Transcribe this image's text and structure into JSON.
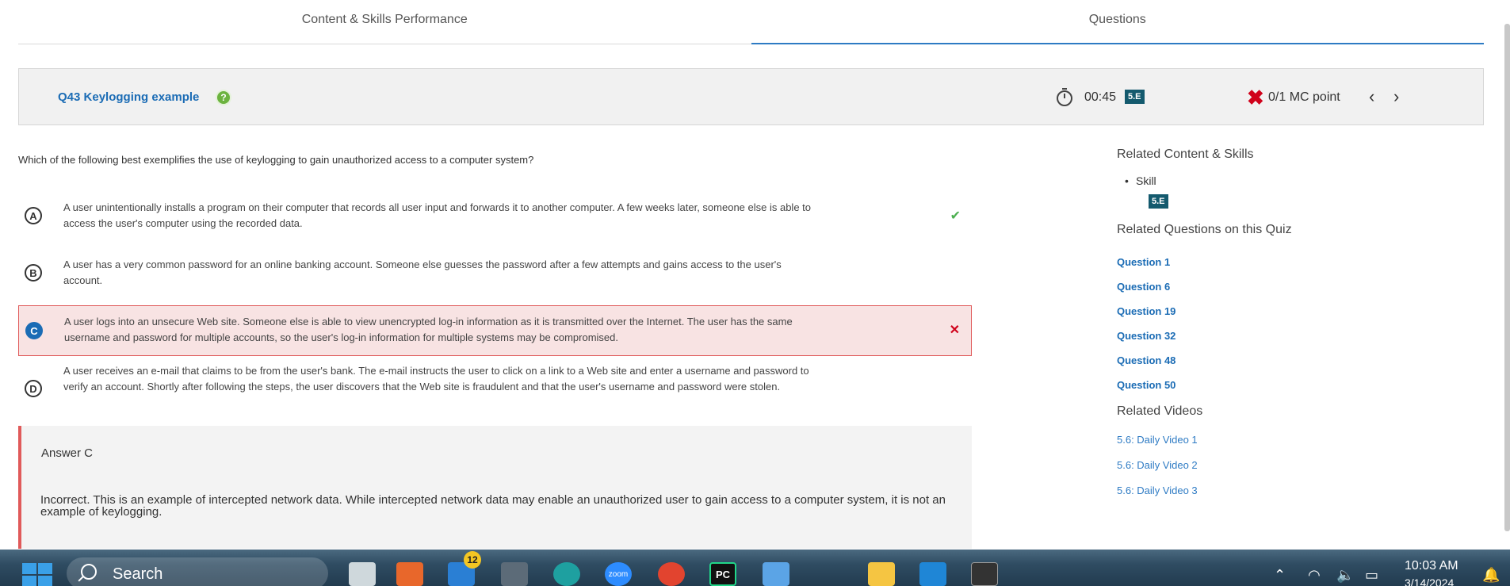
{
  "tabs": [
    {
      "label": "Content & Skills Performance"
    },
    {
      "label": "Questions"
    }
  ],
  "question_bar": {
    "title": "Q43 Keylogging example",
    "help_symbol": "?",
    "timer": "00:45",
    "skill_badge": "5.E",
    "score": "0/1 MC point",
    "prev_symbol": "‹",
    "next_symbol": "›"
  },
  "question": {
    "prompt": "Which of the following best exemplifies the use of keylogging to gain unauthorized access to a computer system?",
    "choices": [
      {
        "letter": "A",
        "text": "A user unintentionally installs a program on their computer that records all user input and forwards it to another computer. A few weeks later, someone else is able to access the user's computer using the recorded data.",
        "status": "correct"
      },
      {
        "letter": "B",
        "text": "A user has a very common password for an online banking account. Someone else guesses the password after a few attempts and gains access to the user's account.",
        "status": "none"
      },
      {
        "letter": "C",
        "text": "A user logs into an unsecure Web site. Someone else is able to view unencrypted log-in information as it is transmitted over the Internet. The user has the same username and password for multiple accounts, so the user's log-in information for multiple systems may be compromised.",
        "status": "selected-wrong"
      },
      {
        "letter": "D",
        "text": "A user receives an e-mail that claims to be from the user's bank. The e-mail instructs the user to click on a link to a Web site and enter a username and password to verify an account. Shortly after following the steps, the user discovers that the Web site is fraudulent and that the user's username and password were stolen.",
        "status": "none"
      }
    ]
  },
  "answer": {
    "title": "Answer C",
    "explanation": "Incorrect. This is an example of intercepted network data. While intercepted network data may enable an unauthorized user to gain access to a computer system, it is not an example of keylogging."
  },
  "related": {
    "content_heading": "Related Content & Skills",
    "skill_label": "Skill",
    "skill_badge": "5.E",
    "questions_heading": "Related Questions on this Quiz",
    "questions": [
      "Question 1",
      "Question 6",
      "Question 19",
      "Question 32",
      "Question 48",
      "Question 50"
    ],
    "videos_heading": "Related Videos",
    "videos": [
      "5.6: Daily Video 1",
      "5.6: Daily Video 2",
      "5.6: Daily Video 3"
    ]
  },
  "taskbar": {
    "search_placeholder": "Search",
    "mail_badge": "12",
    "time": "10:03 AM",
    "date": "3/14/2024",
    "icons": [
      "start-icon",
      "file-explorer-icon",
      "office-icon",
      "mail-icon",
      "calculator-icon",
      "edge-icon",
      "zoom-icon",
      "chrome-icon",
      "pycharm-icon",
      "notepad-icon",
      "folder-icon",
      "vscode-icon",
      "terminal-icon"
    ],
    "zoom_label": "zoom",
    "pycharm_label": "PC"
  },
  "colors": {
    "link": "#1b6cb5",
    "skill_badge_bg": "#145a6e",
    "wrong_bg": "#f8e3e3",
    "wrong_border": "#e05a5a",
    "correct": "#4caf50",
    "x_red": "#d0021b"
  }
}
